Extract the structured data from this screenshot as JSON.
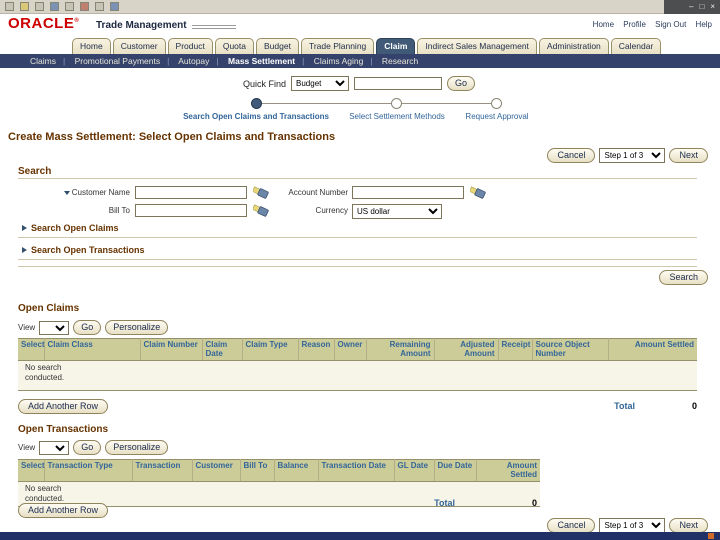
{
  "colors": {
    "oracle_red": "#cc0000",
    "header_text": "#663300",
    "tab_active_bg": "#405a78",
    "subnav_bg": "#35426b",
    "table_header_bg": "#cccc99",
    "column_header_text": "#336699"
  },
  "window": {
    "minimize": "–",
    "maximize": "□",
    "close": "×"
  },
  "branding": {
    "logo": "ORACLE",
    "registered": "®",
    "product": "Trade Management"
  },
  "top_links": [
    {
      "label": "Home"
    },
    {
      "label": "Profile"
    },
    {
      "label": "Sign Out"
    },
    {
      "label": "Help"
    }
  ],
  "tabs": [
    {
      "label": "Home"
    },
    {
      "label": "Customer"
    },
    {
      "label": "Product"
    },
    {
      "label": "Quota"
    },
    {
      "label": "Budget"
    },
    {
      "label": "Trade Planning"
    },
    {
      "label": "Claim"
    },
    {
      "label": "Indirect Sales Management"
    },
    {
      "label": "Administration"
    },
    {
      "label": "Calendar"
    }
  ],
  "subnav": [
    {
      "label": "Claims"
    },
    {
      "label": "Promotional Payments"
    },
    {
      "label": "Autopay"
    },
    {
      "label": "Mass Settlement"
    },
    {
      "label": "Claims Aging"
    },
    {
      "label": "Research"
    }
  ],
  "quick_find": {
    "label": "Quick Find",
    "category": "Budget",
    "value": "",
    "go": "Go"
  },
  "train": {
    "steps": [
      {
        "label": "Search Open Claims and Transactions",
        "state": "current"
      },
      {
        "label": "Select Settlement Methods",
        "state": "upcoming"
      },
      {
        "label": "Request Approval",
        "state": "upcoming"
      }
    ]
  },
  "page_title": "Create Mass Settlement: Select Open Claims and Transactions",
  "wizard": {
    "cancel": "Cancel",
    "step": "Step 1 of 3",
    "next": "Next"
  },
  "search": {
    "heading": "Search",
    "customer_name_label": "Customer Name",
    "account_number_label": "Account Number",
    "bill_to_label": "Bill To",
    "currency_label": "Currency",
    "currency_value": "US dollar",
    "open_claims_link": "Search Open Claims",
    "open_transactions_link": "Search Open Transactions",
    "search_button": "Search"
  },
  "open_claims": {
    "heading": "Open Claims",
    "view_label": "View",
    "go": "Go",
    "personalize": "Personalize",
    "columns": [
      "Select",
      "Claim Class",
      "Claim Number",
      "Claim Date",
      "Claim Type",
      "Reason",
      "Owner",
      "Remaining Amount",
      "Adjusted Amount",
      "Receipt",
      "Source Object Number",
      "Amount Settled"
    ],
    "empty_message": "No search conducted.",
    "add_row": "Add Another Row",
    "total_label": "Total",
    "total_value": "0"
  },
  "open_transactions": {
    "heading": "Open Transactions",
    "view_label": "View",
    "go": "Go",
    "personalize": "Personalize",
    "columns": [
      "Select",
      "Transaction Type",
      "Transaction",
      "Customer",
      "Bill To",
      "Balance",
      "Transaction Date",
      "GL Date",
      "Due Date",
      "Amount Settled"
    ],
    "empty_message": "No search conducted.",
    "add_row": "Add Another Row",
    "total_label": "Total",
    "total_value": "0"
  }
}
